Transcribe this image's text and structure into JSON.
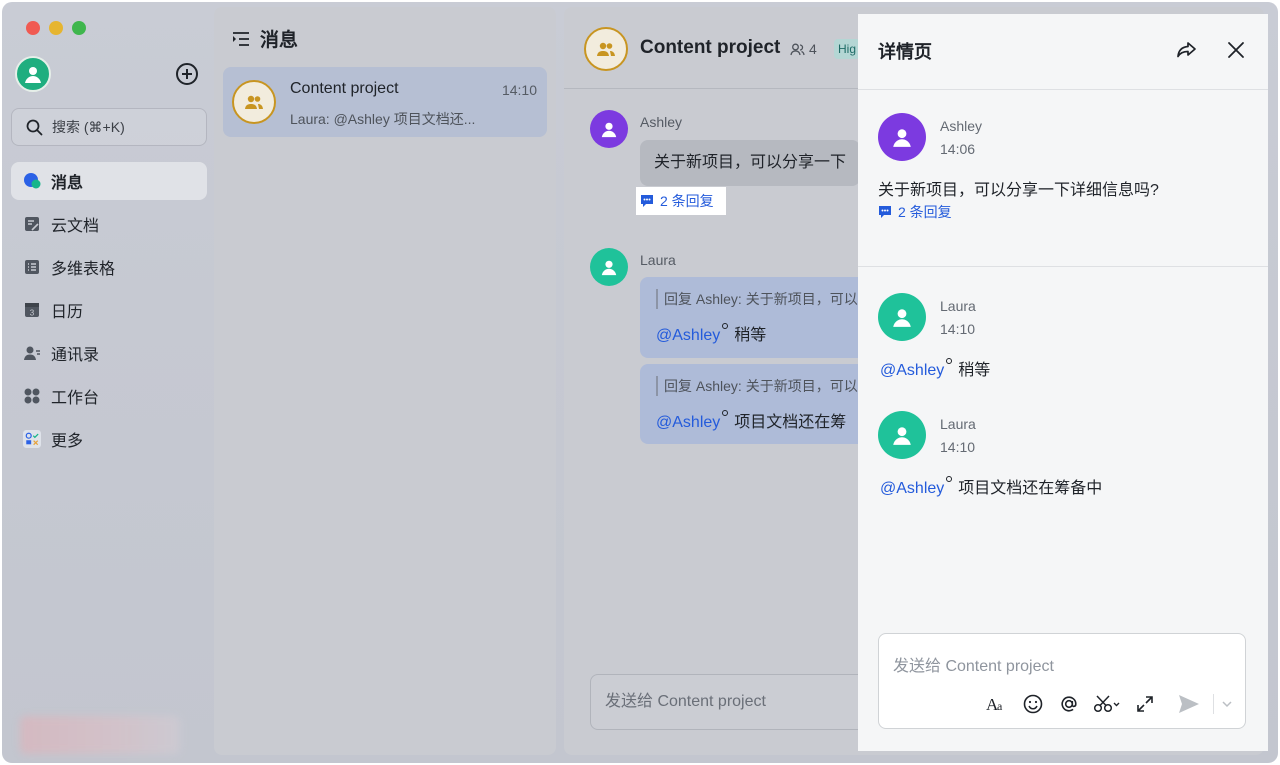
{
  "sidebar": {
    "search_placeholder": "搜索 (⌘+K)",
    "items": [
      {
        "label": "消息",
        "icon": "message-icon"
      },
      {
        "label": "云文档",
        "icon": "docs-icon"
      },
      {
        "label": "多维表格",
        "icon": "base-icon"
      },
      {
        "label": "日历",
        "icon": "calendar-icon"
      },
      {
        "label": "通讯录",
        "icon": "contacts-icon"
      },
      {
        "label": "工作台",
        "icon": "workplace-icon"
      },
      {
        "label": "更多",
        "icon": "more-apps-icon"
      }
    ],
    "calendar_day": "3"
  },
  "message_list": {
    "title": "消息",
    "chats": [
      {
        "name": "Content project",
        "time": "14:10",
        "preview": "Laura: @Ashley 项目文档还..."
      }
    ]
  },
  "chat": {
    "title": "Content project",
    "member_count": "4",
    "tag": "Hig",
    "messages": [
      {
        "sender": "Ashley",
        "text": "关于新项目，可以分享一下",
        "reply_count": "2 条回复"
      },
      {
        "sender": "Laura",
        "quote1": "回复 Ashley: 关于新项目，可以",
        "mention": "@Ashley",
        "text1": "稍等",
        "quote2": "回复 Ashley: 关于新项目，可以",
        "text2": "项目文档还在筹"
      }
    ],
    "input_placeholder": "发送给 Content project"
  },
  "details": {
    "title": "详情页",
    "root": {
      "sender": "Ashley",
      "time": "14:06",
      "text": "关于新项目，可以分享一下详细信息吗?",
      "reply_count": "2 条回复"
    },
    "replies": [
      {
        "sender": "Laura",
        "time": "14:10",
        "mention": "@Ashley",
        "text": "稍等"
      },
      {
        "sender": "Laura",
        "time": "14:10",
        "mention": "@Ashley",
        "text": "项目文档还在筹备中"
      }
    ],
    "input_placeholder": "发送给 Content project"
  },
  "colors": {
    "ashley_avatar": "#7c3ae0",
    "laura_avatar": "#1fc29a",
    "link": "#245bdb",
    "group_avatar_border": "#c89521"
  }
}
